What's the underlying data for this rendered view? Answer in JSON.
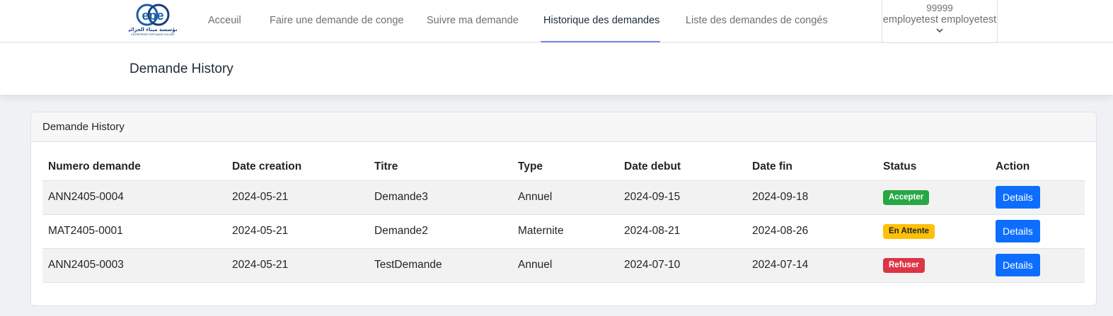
{
  "brand": {
    "logo_letters": "epe",
    "logo_arabic": "مؤسسة ميناء الجزائر",
    "logo_subtitle": "ENTREPRISE PORTUAIRE D'ALGER",
    "colors": {
      "primary": "#1e5fa8",
      "dark": "#163e7a"
    }
  },
  "nav": {
    "items": [
      {
        "label": "Acceuil",
        "active": false
      },
      {
        "label": "Faire une demande de conge",
        "active": false
      },
      {
        "label": "Suivre ma demande",
        "active": false
      },
      {
        "label": "Historique des demandes",
        "active": true
      },
      {
        "label": "Liste des demandes de congés",
        "active": false
      }
    ],
    "underline_color": "#7b86f0"
  },
  "user": {
    "id": "99999",
    "name": "employetest employetest",
    "dropdown_icon": "chevron-down-icon"
  },
  "page": {
    "title": "Demande History"
  },
  "card": {
    "title": "Demande History",
    "columns": [
      "Numero demande",
      "Date creation",
      "Titre",
      "Type",
      "Date debut",
      "Date fin",
      "Status",
      "Action"
    ],
    "rows": [
      {
        "numero": "ANN2405-0004",
        "date_creation": "2024-05-21",
        "titre": "Demande3",
        "type": "Annuel",
        "date_debut": "2024-09-15",
        "date_fin": "2024-09-18",
        "status": "Accepter",
        "status_color": "#28a745",
        "action": "Details"
      },
      {
        "numero": "MAT2405-0001",
        "date_creation": "2024-05-21",
        "titre": "Demande2",
        "type": "Maternite",
        "date_debut": "2024-08-21",
        "date_fin": "2024-08-26",
        "status": "En Attente",
        "status_color": "#ffc107",
        "action": "Details"
      },
      {
        "numero": "ANN2405-0003",
        "date_creation": "2024-05-21",
        "titre": "TestDemande",
        "type": "Annuel",
        "date_debut": "2024-07-10",
        "date_fin": "2024-07-14",
        "status": "Refuser",
        "status_color": "#dc3545",
        "action": "Details"
      }
    ],
    "action_button_color": "#0d6efd"
  }
}
